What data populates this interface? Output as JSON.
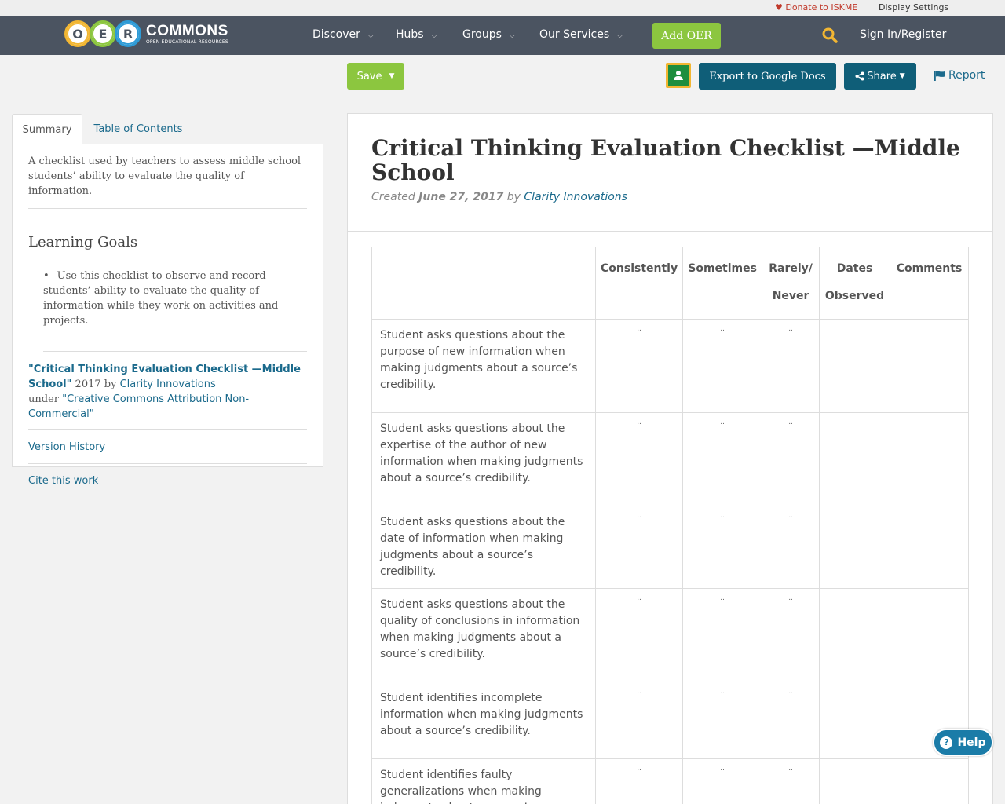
{
  "util": {
    "donate": "Donate to ISKME",
    "display_settings": "Display Settings"
  },
  "logo": {
    "letters": [
      "O",
      "E",
      "R"
    ],
    "word": "COMMONS",
    "tagline": "OPEN EDUCATIONAL RESOURCES"
  },
  "nav": {
    "items": [
      {
        "label": "Discover"
      },
      {
        "label": "Hubs"
      },
      {
        "label": "Groups"
      },
      {
        "label": "Our Services"
      }
    ],
    "add_oer": "Add OER",
    "sign_in": "Sign In/Register"
  },
  "toolbar": {
    "save": "Save",
    "export": "Export to Google Docs",
    "share": "Share",
    "report": "Report"
  },
  "sidebar": {
    "tabs": [
      "Summary",
      "Table of Contents"
    ],
    "summary": "A checklist used by teachers to assess middle school students’ ability to evaluate the quality of information.",
    "learning_goals_title": "Learning Goals",
    "learning_goals": [
      "Use this checklist to observe and record students’ ability to evaluate the quality of information while they work on activities and projects."
    ],
    "attribution": {
      "title": "\"Critical Thinking Evaluation Checklist —Middle School\"",
      "year_by": " 2017 by ",
      "author": "Clarity Innovations",
      "under": "under ",
      "license": "\"Creative Commons Attribution Non-Commercial\""
    },
    "version_history": "Version History",
    "cite": "Cite this work"
  },
  "doc": {
    "title": "Critical Thinking Evaluation Checklist —Middle School",
    "created_label": "Created ",
    "date": "June 27, 2017",
    "by": " by ",
    "author": "Clarity Innovations"
  },
  "table": {
    "headers": [
      "",
      "Consistently",
      "Sometimes",
      "Rarely/ Never",
      "Dates Observed",
      "Comments"
    ],
    "mark": "..",
    "rows": [
      "Student asks questions about the purpose of new information when making judgments about a source’s credibility.",
      "Student asks questions about the expertise of the author of new information when making judgments about a source’s credibility.",
      "Student asks questions about the date of information when making judgments about a source’s credibility.",
      "Student asks questions about the quality of conclusions in information when making judgments about a source’s credibility.",
      "Student identifies incomplete information when making judgments about a source’s credibility.",
      "Student identifies faulty generalizations when making judgments about a source’s credibility."
    ]
  },
  "help": "Help",
  "colors": {
    "nav_bg": "#4b5461",
    "green": "#8cc63f",
    "teal": "#0f5e78",
    "link": "#1b6a8c"
  }
}
